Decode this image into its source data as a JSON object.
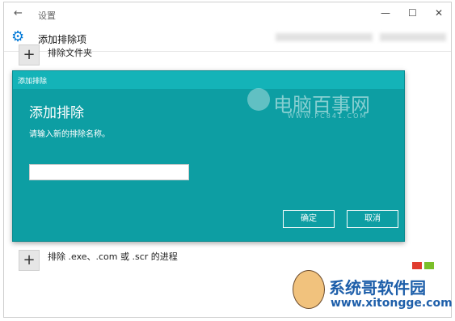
{
  "window": {
    "app_title": "设置",
    "back": "←",
    "minimize": "—",
    "maximize": "☐",
    "close": "✕"
  },
  "header": {
    "title": "添加排除项",
    "gear_icon": "⚙"
  },
  "list": {
    "add_symbol": "+",
    "item1_label": "排除文件夹",
    "item2_label": "排除 .exe、.com 或 .scr 的进程"
  },
  "dialog": {
    "caption": "添加排除",
    "heading": "添加排除",
    "description": "请输入新的排除名称。",
    "input_value": "",
    "ok_label": "确定",
    "cancel_label": "取消"
  },
  "watermarks": {
    "site1_name": "电脑百事网",
    "site1_url": "WWW.PC841.COM",
    "site2_name": "系统哥软件园",
    "site2_url": "www.xitongge.com"
  },
  "colors": {
    "dialog_bg": "#0d9ea3",
    "dialog_bar": "#14b3b8",
    "accent": "#0078d7",
    "logo_red": "#e03c2f",
    "logo_green": "#7bbf2a"
  }
}
